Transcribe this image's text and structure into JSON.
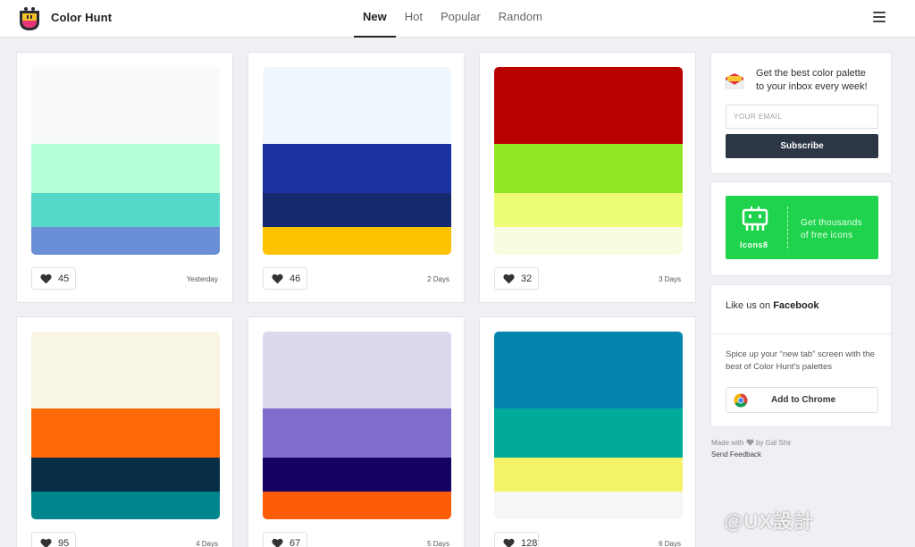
{
  "header": {
    "brand": "Color Hunt",
    "nav": [
      {
        "label": "New",
        "active": true
      },
      {
        "label": "Hot",
        "active": false
      },
      {
        "label": "Popular",
        "active": false
      },
      {
        "label": "Random",
        "active": false
      }
    ],
    "menu_icon": "hamburger-icon"
  },
  "cards": [
    {
      "colors": [
        "#f9fafb",
        "#b5fed8",
        "#55d8c7",
        "#6a8ed5"
      ],
      "likes": "45",
      "date": "Yesterday"
    },
    {
      "colors": [
        "#eff7fe",
        "#1a33a0",
        "#152a6e",
        "#fec200"
      ],
      "likes": "46",
      "date": "2 Days"
    },
    {
      "colors": [
        "#b80000",
        "#91e625",
        "#eefd76",
        "#f8fde2"
      ],
      "likes": "32",
      "date": "3 Days"
    },
    {
      "colors": [
        "#f8f5e4",
        "#fe6a09",
        "#062c46",
        "#00868c"
      ],
      "likes": "95",
      "date": "4 Days"
    },
    {
      "colors": [
        "#dcd9ec",
        "#7f6ccc",
        "#150064",
        "#fe5d07"
      ],
      "likes": "67",
      "date": "5 Days"
    },
    {
      "colors": [
        "#0385ae",
        "#00ab9b",
        "#f4f266",
        "#f6f6f6"
      ],
      "likes": "128",
      "date": "6 Days"
    }
  ],
  "newsletter": {
    "line1": "Get the best color palette",
    "line2": "to your inbox every week!",
    "email_placeholder": "YOUR EMAIL",
    "subscribe_label": "Subscribe"
  },
  "icons8": {
    "label": "Icons8",
    "line1": "Get thousands",
    "line2": "of free icons",
    "color": "#1fd34c"
  },
  "facebook": {
    "prefix": "Like us on ",
    "brand": "Facebook",
    "desc": "Spice up your “new tab” screen with the best of Color Hunt's palettes",
    "chrome_label": "Add to Chrome"
  },
  "footer": {
    "made_prefix": "Made with",
    "made_suffix": "by Gal Shir",
    "feedback": "Send Feedback"
  },
  "watermark": "@UX設計"
}
